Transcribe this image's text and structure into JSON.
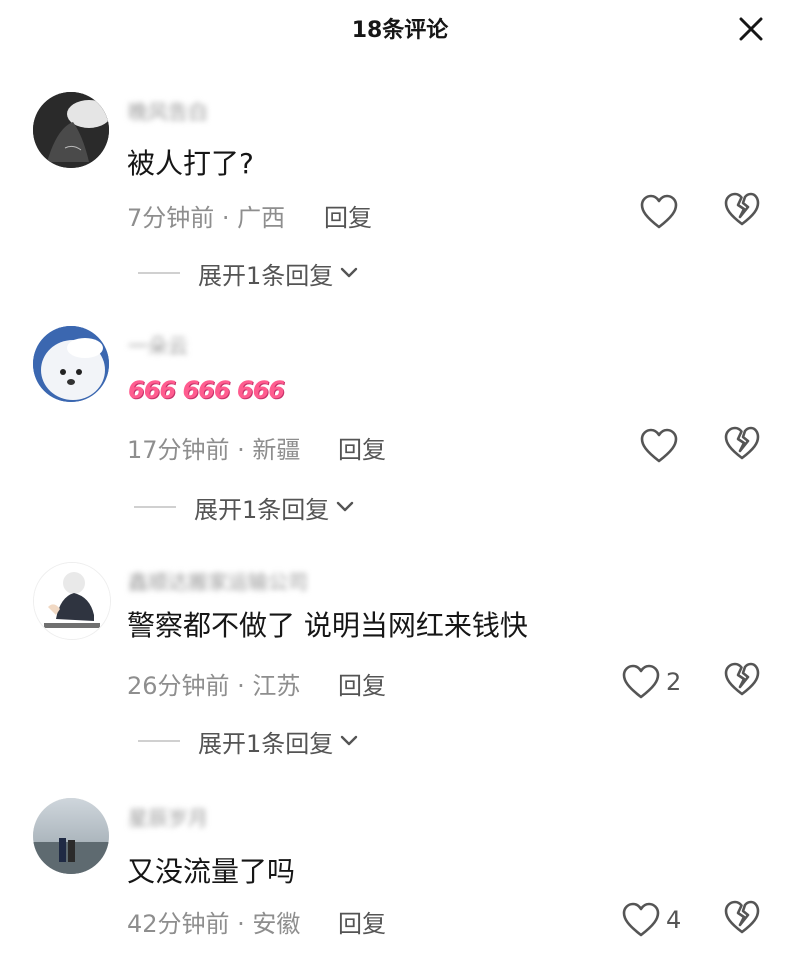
{
  "header": {
    "title": "18条评论",
    "close_icon": "close-icon"
  },
  "comments": [
    {
      "username": "晚风告白",
      "text": "被人打了?",
      "meta": "7分钟前 · 广西",
      "reply_label": "回复",
      "likes": "",
      "expand_label": "展开1条回复"
    },
    {
      "username": "一朵云",
      "text": "666 666 666",
      "meta": "17分钟前 · 新疆",
      "reply_label": "回复",
      "likes": "",
      "expand_label": "展开1条回复"
    },
    {
      "username": "鑫顺达搬家运输公司",
      "text": "警察都不做了 说明当网红来钱快",
      "meta": "26分钟前 · 江苏",
      "reply_label": "回复",
      "likes": "2",
      "expand_label": "展开1条回复"
    },
    {
      "username": "星辰岁月",
      "text": "又没流量了吗",
      "meta": "42分钟前 · 安徽",
      "reply_label": "回复",
      "likes": "4",
      "expand_label": ""
    }
  ],
  "colors": {
    "text": "#161616",
    "meta": "#8e8e8e",
    "reply": "#545454",
    "emoji": "#ff5c8f"
  }
}
